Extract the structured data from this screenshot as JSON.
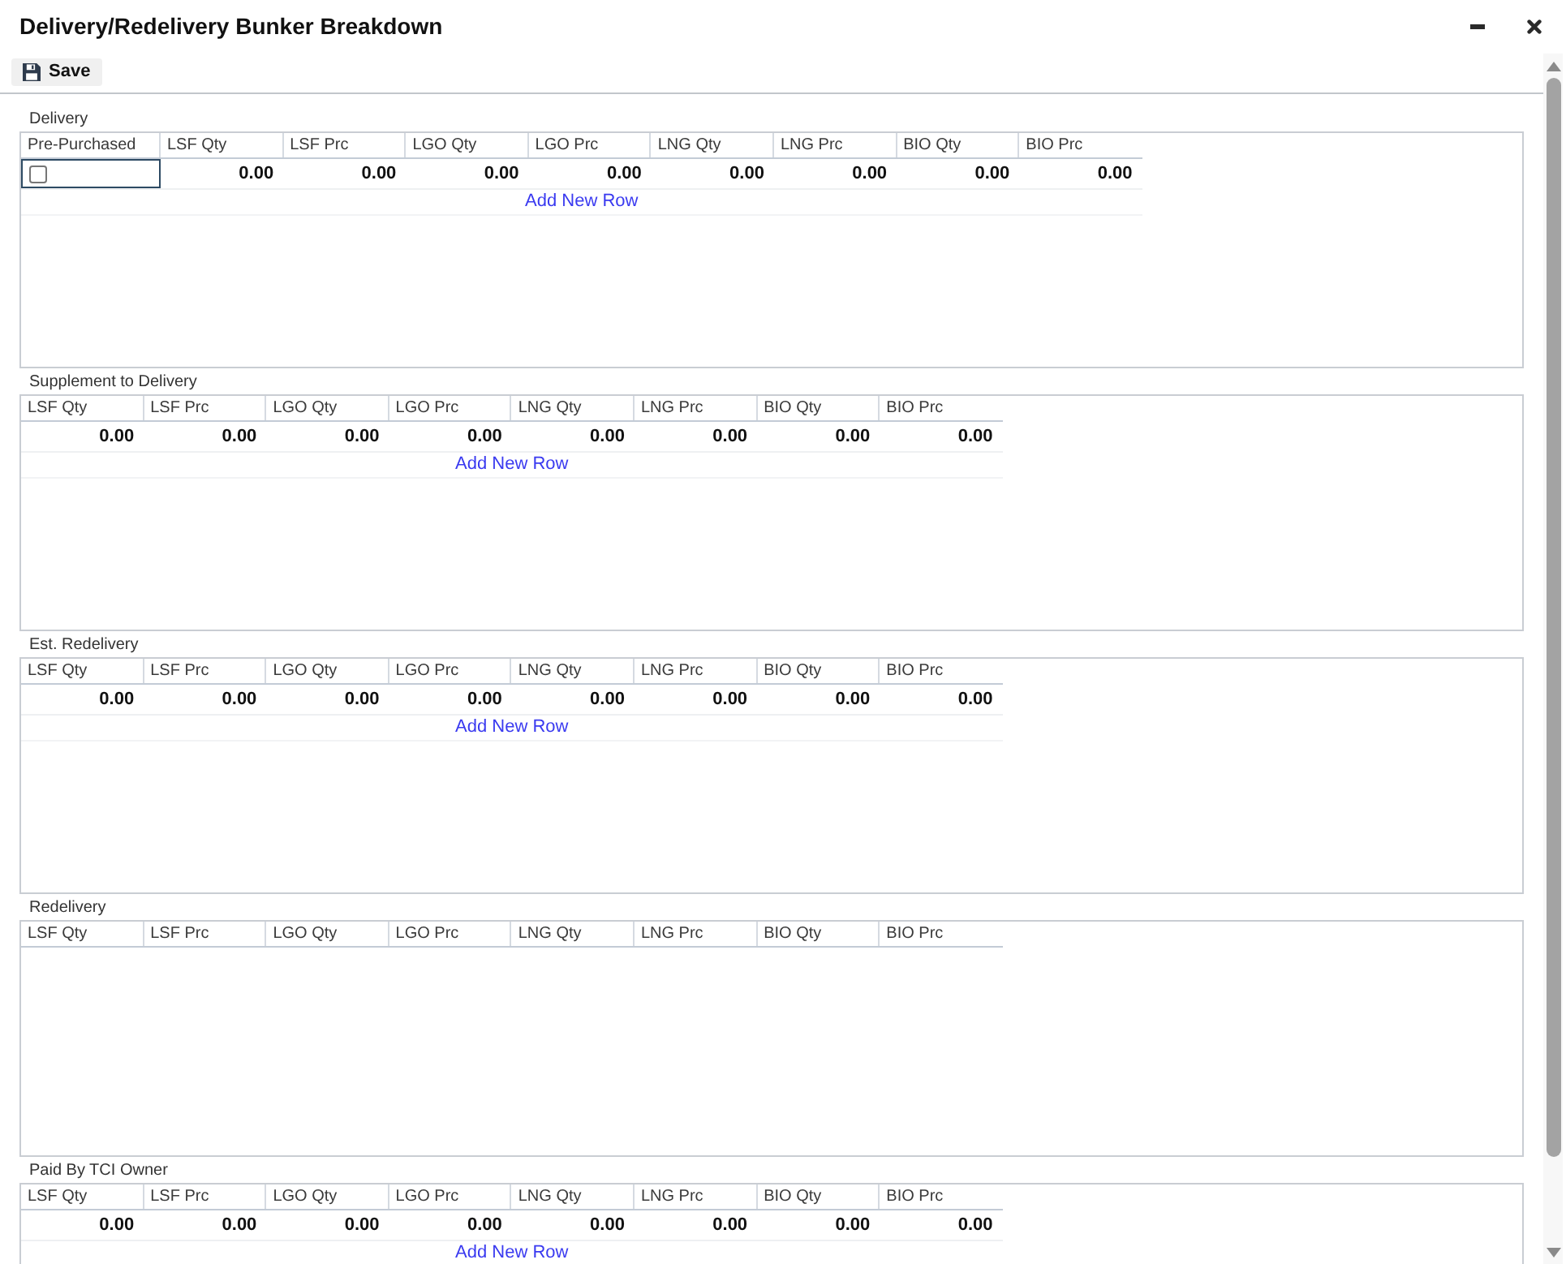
{
  "window": {
    "title": "Delivery/Redelivery Bunker Breakdown"
  },
  "toolbar": {
    "save_button": "Save"
  },
  "sections": [
    {
      "title": "Delivery",
      "columns": [
        "Pre-Purchased",
        "LSF Qty",
        "LSF Prc",
        "LGO Qty",
        "LGO Prc",
        "LNG Qty",
        "LNG Prc",
        "BIO Qty",
        "BIO Prc"
      ],
      "rows": [
        {
          "cells": [
            {
              "kind": "checkbox",
              "checked": false,
              "focused": true
            },
            {
              "kind": "number",
              "value": "0.00",
              "focused": false
            },
            {
              "kind": "number",
              "value": "0.00",
              "focused": false
            },
            {
              "kind": "number",
              "value": "0.00",
              "focused": false
            },
            {
              "kind": "number",
              "value": "0.00",
              "focused": false
            },
            {
              "kind": "number",
              "value": "0.00",
              "focused": false
            },
            {
              "kind": "number",
              "value": "0.00",
              "focused": false
            },
            {
              "kind": "number",
              "value": "0.00",
              "focused": false
            },
            {
              "kind": "number",
              "value": "0.00",
              "focused": false
            }
          ]
        }
      ],
      "add_row_link": "Add New Row"
    },
    {
      "title": "Supplement to Delivery",
      "columns": [
        "LSF Qty",
        "LSF Prc",
        "LGO Qty",
        "LGO Prc",
        "LNG Qty",
        "LNG Prc",
        "BIO Qty",
        "BIO Prc"
      ],
      "rows": [
        {
          "cells": [
            {
              "kind": "number",
              "value": "0.00",
              "focused": false
            },
            {
              "kind": "number",
              "value": "0.00",
              "focused": false
            },
            {
              "kind": "number",
              "value": "0.00",
              "focused": false
            },
            {
              "kind": "number",
              "value": "0.00",
              "focused": false
            },
            {
              "kind": "number",
              "value": "0.00",
              "focused": false
            },
            {
              "kind": "number",
              "value": "0.00",
              "focused": false
            },
            {
              "kind": "number",
              "value": "0.00",
              "focused": false
            },
            {
              "kind": "number",
              "value": "0.00",
              "focused": false
            }
          ]
        }
      ],
      "add_row_link": "Add New Row"
    },
    {
      "title": "Est. Redelivery",
      "columns": [
        "LSF Qty",
        "LSF Prc",
        "LGO Qty",
        "LGO Prc",
        "LNG Qty",
        "LNG Prc",
        "BIO Qty",
        "BIO Prc"
      ],
      "rows": [
        {
          "cells": [
            {
              "kind": "number",
              "value": "0.00",
              "focused": false
            },
            {
              "kind": "number",
              "value": "0.00",
              "focused": false
            },
            {
              "kind": "number",
              "value": "0.00",
              "focused": false
            },
            {
              "kind": "number",
              "value": "0.00",
              "focused": false
            },
            {
              "kind": "number",
              "value": "0.00",
              "focused": false
            },
            {
              "kind": "number",
              "value": "0.00",
              "focused": false
            },
            {
              "kind": "number",
              "value": "0.00",
              "focused": false
            },
            {
              "kind": "number",
              "value": "0.00",
              "focused": false
            }
          ]
        }
      ],
      "add_row_link": "Add New Row"
    },
    {
      "title": "Redelivery",
      "columns": [
        "LSF Qty",
        "LSF Prc",
        "LGO Qty",
        "LGO Prc",
        "LNG Qty",
        "LNG Prc",
        "BIO Qty",
        "BIO Prc"
      ]
    },
    {
      "title": "Paid By TCI Owner",
      "columns": [
        "LSF Qty",
        "LSF Prc",
        "LGO Qty",
        "LGO Prc",
        "LNG Qty",
        "LNG Prc",
        "BIO Qty",
        "BIO Prc"
      ],
      "rows": [
        {
          "cells": [
            {
              "kind": "number",
              "value": "0.00",
              "focused": false
            },
            {
              "kind": "number",
              "value": "0.00",
              "focused": false
            },
            {
              "kind": "number",
              "value": "0.00",
              "focused": false
            },
            {
              "kind": "number",
              "value": "0.00",
              "focused": false
            },
            {
              "kind": "number",
              "value": "0.00",
              "focused": false
            },
            {
              "kind": "number",
              "value": "0.00",
              "focused": false
            },
            {
              "kind": "number",
              "value": "0.00",
              "focused": false
            },
            {
              "kind": "number",
              "value": "0.00",
              "focused": false
            }
          ]
        }
      ],
      "add_row_link": "Add New Row"
    }
  ]
}
